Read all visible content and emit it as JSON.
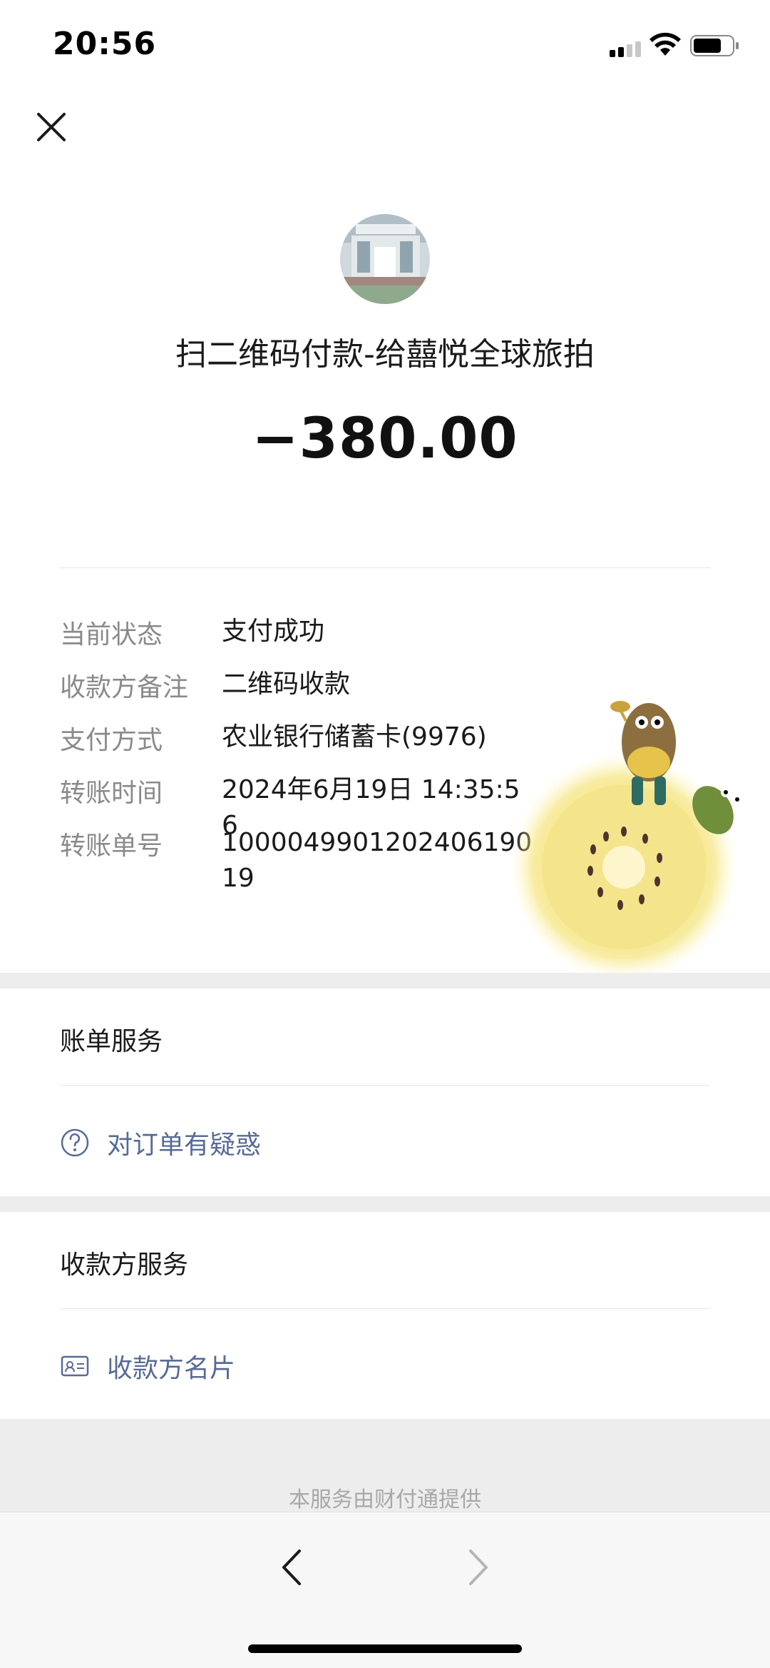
{
  "status_bar": {
    "time": "20:56"
  },
  "header": {
    "payee_title": "扫二维码付款-给囍悦全球旅拍",
    "amount": "−380.00"
  },
  "details": {
    "status_label": "当前状态",
    "status_value": "支付成功",
    "remark_label": "收款方备注",
    "remark_value": "二维码收款",
    "method_label": "支付方式",
    "method_value": "农业银行储蓄卡(9976)",
    "time_label": "转账时间",
    "time_value": "2024年6月19日 14:35:56",
    "order_label": "转账单号",
    "order_value": "100004990120240619019"
  },
  "bill_service": {
    "title": "账单服务",
    "link": "对订单有疑惑"
  },
  "payee_service": {
    "title": "收款方服务",
    "link": "收款方名片"
  },
  "footer": {
    "text": "本服务由财付通提供"
  },
  "colors": {
    "link": "#576b95",
    "label": "#8a8a8a",
    "gap": "#ededed"
  },
  "icons": [
    "close-icon",
    "question-circle-icon",
    "business-card-icon",
    "chevron-left-icon",
    "chevron-right-icon"
  ]
}
